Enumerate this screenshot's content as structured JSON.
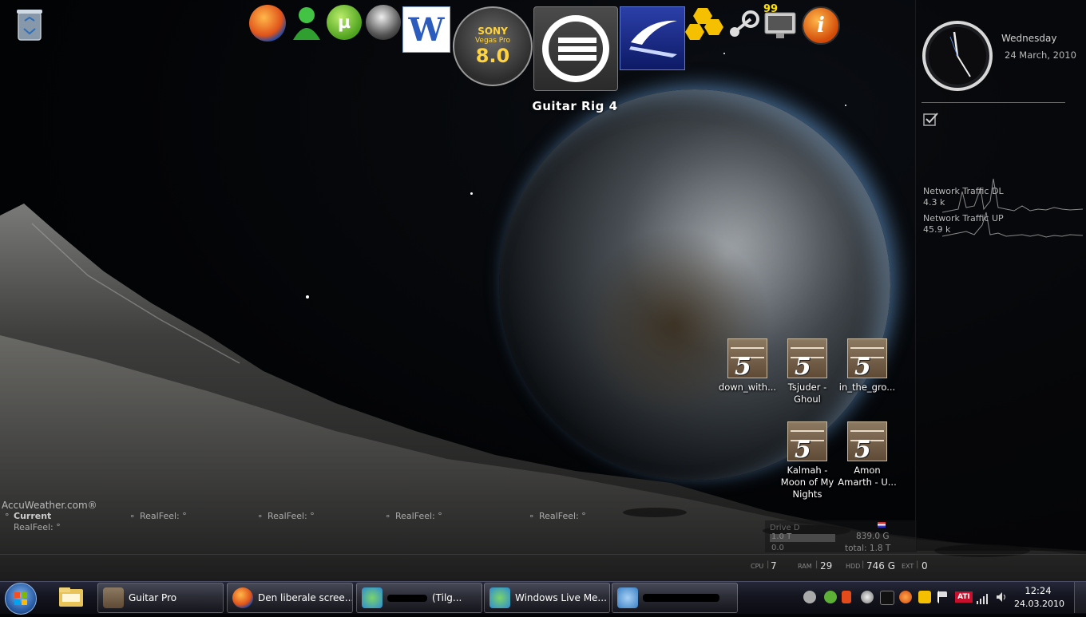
{
  "desktop": {
    "recycle_bin": "recycle-bin-icon",
    "dock": {
      "hover_label": "Guitar Rig 4",
      "items": [
        "firefox-icon",
        "msn-messenger-icon",
        "utorrent-icon",
        "helmet-icon",
        "word-icon",
        "sony-vegas-icon",
        "guitar-rig-icon",
        "app-blue-icon",
        "honeycomb-icon",
        "steam-icon",
        "monitor-icon",
        "info-icon"
      ],
      "vegas_text": [
        "SONY",
        "Vegas Pro",
        "8.0"
      ],
      "word_letter": "W",
      "monitor_badge": "99"
    },
    "icons": [
      {
        "label": "down_with..."
      },
      {
        "label": "Tsjuder - Ghoul"
      },
      {
        "label": "in_the_gro..."
      },
      {
        "label": "Kalmah - Moon of My Nights"
      },
      {
        "label": "Amon Amarth - U..."
      }
    ]
  },
  "gadgets": {
    "clock": {
      "day": "Wednesday",
      "date": "24 March, 2010"
    },
    "network": {
      "dl_label": "Network Traffic DL",
      "dl_value": "4.3 k",
      "up_label": "Network Traffic UP",
      "up_value": "45.9 k"
    },
    "weather": {
      "brand": "AccuWeather.com®",
      "current_label": "Current",
      "realfeel": "RealFeel: °",
      "forecast": [
        "RealFeel: °",
        "RealFeel: °",
        "RealFeel: °",
        "RealFeel: °"
      ]
    },
    "drive": {
      "name": "Drive D",
      "used": "1.0 T",
      "free": "839.0 G",
      "pct": "0.0",
      "total": "total: 1.8 T"
    },
    "system": {
      "cpu_label": "CPU",
      "cpu_value": "7",
      "ram_label": "RAM",
      "ram_value": "29",
      "hdd_label": "HDD",
      "hdd_value": "746 G",
      "ext_label": "EXT",
      "ext_value": "0"
    }
  },
  "taskbar": {
    "tasks": [
      {
        "label": "Guitar Pro",
        "icon": "guitar-pro-icon"
      },
      {
        "label": "Den liberale scree...",
        "icon": "firefox-icon"
      },
      {
        "label": "(Tilg...",
        "icon": "messenger-icon"
      },
      {
        "label": "Windows Live Me...",
        "icon": "messenger-icon"
      },
      {
        "label": "",
        "icon": "messenger-chat-icon"
      }
    ],
    "clock": {
      "time": "12:24",
      "date": "24.03.2010"
    },
    "tray_ati": "ATI"
  }
}
